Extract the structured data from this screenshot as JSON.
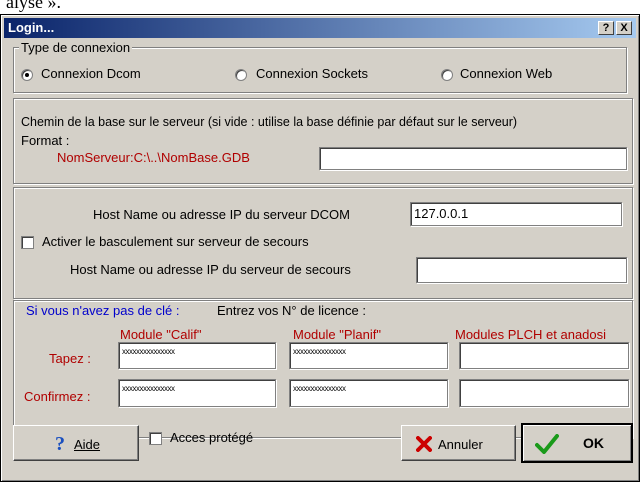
{
  "top_fragment": "alyse ».",
  "window": {
    "title": "Login...",
    "help_btn": "?",
    "close_btn": "X"
  },
  "connection": {
    "legend": "Type de connexion",
    "options": [
      "Connexion Dcom",
      "Connexion Sockets",
      "Connexion Web"
    ],
    "selected": "Connexion Dcom"
  },
  "path": {
    "description": "Chemin de la base sur le serveur (si vide : utilise la base définie par défaut sur le serveur)",
    "format_label": "Format :",
    "format_example": "NomServeur:C:\\..\\NomBase.GDB",
    "value": ""
  },
  "dcom": {
    "host_label": "Host Name ou adresse IP du serveur DCOM",
    "host_value": "127.0.0.1",
    "backup_checkbox_label": "Activer le basculement sur serveur de secours",
    "backup_checked": false,
    "backup_host_label": "Host Name ou adresse IP du serveur de secours",
    "backup_host_value": ""
  },
  "license": {
    "no_key_text": "Si vous n'avez pas de clé :",
    "enter_text": "Entrez vos N° de licence :",
    "modules": [
      "Module \"Calif\"",
      "Module \"Planif\"",
      "Modules PLCH et anadosi"
    ],
    "row_labels": [
      "Tapez :",
      "Confirmez :"
    ],
    "values": [
      [
        "xxxxxxxxxxxxxxx",
        "xxxxxxxxxxxxxxx",
        ""
      ],
      [
        "xxxxxxxxxxxxxxx",
        "xxxxxxxxxxxxxxx",
        ""
      ]
    ]
  },
  "buttons": {
    "help": "Aide",
    "protected_label": "Acces protégé",
    "protected_checked": false,
    "cancel": "Annuler",
    "ok": "OK"
  },
  "colors": {
    "titlebar": "#0a246a",
    "accent_red": "#b00000",
    "accent_blue": "#0000cc",
    "ok_check": "#1a9a1a",
    "cancel_x": "#cc0000"
  }
}
